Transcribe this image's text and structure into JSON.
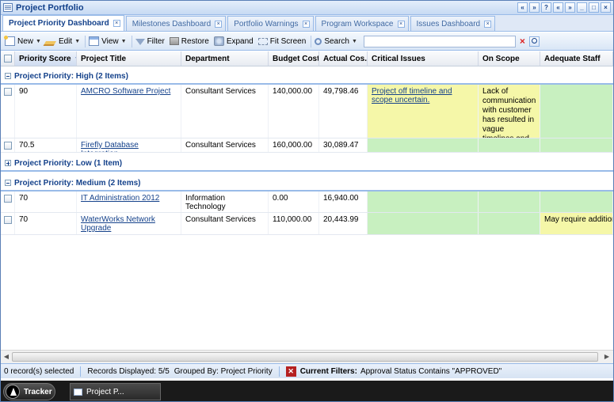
{
  "window": {
    "title": "Project Portfolio",
    "buttons": [
      "«",
      "»",
      "?",
      "«",
      "»",
      "_",
      "□",
      "×"
    ]
  },
  "tabs": [
    {
      "label": "Project Priority Dashboard",
      "active": true
    },
    {
      "label": "Milestones Dashboard",
      "active": false
    },
    {
      "label": "Portfolio Warnings",
      "active": false
    },
    {
      "label": "Program Workspace",
      "active": false
    },
    {
      "label": "Issues Dashboard",
      "active": false
    }
  ],
  "toolbar": {
    "new_label": "New",
    "edit_label": "Edit",
    "view_label": "View",
    "filter_label": "Filter",
    "restore_label": "Restore",
    "expand_label": "Expand",
    "fit_label": "Fit Screen",
    "search_label": "Search",
    "search_value": ""
  },
  "grid": {
    "columns": [
      "Priority Score",
      "Project Title",
      "Department",
      "Budget Cost...",
      "Actual Cos...",
      "Critical Issues",
      "On Scope",
      "Adequate Staff"
    ],
    "groups": [
      {
        "label": "Project Priority: High (2 Items)",
        "expanded": true,
        "rows": [
          {
            "score": "90",
            "title": "AMCRO Software Project",
            "department": "Consultant Services",
            "budget": "140,000.00",
            "actual": "49,798.46",
            "critical": "Project off timeline and scope uncertain.",
            "scope": "Lack of communication with customer has resulted in vague timelines and deliverables",
            "staff": ""
          },
          {
            "score": "70.5",
            "title": "Firefly Database Integration",
            "department": "Consultant Services",
            "budget": "160,000.00",
            "actual": "30,089.47",
            "critical": "",
            "scope": "",
            "staff": ""
          }
        ]
      },
      {
        "label": "Project Priority: Low (1 Item)",
        "expanded": false,
        "rows": []
      },
      {
        "label": "Project Priority: Medium (2 Items)",
        "expanded": true,
        "rows": [
          {
            "score": "70",
            "title": "IT Administration 2012",
            "department": "Information Technology",
            "budget": "0.00",
            "actual": "16,940.00",
            "critical": "",
            "scope": "",
            "staff": ""
          },
          {
            "score": "70",
            "title": "WaterWorks Network Upgrade",
            "department": "Consultant Services",
            "budget": "110,000.00",
            "actual": "20,443.99",
            "critical": "",
            "scope": "",
            "staff": "May require additional staff to meet deadline"
          }
        ]
      }
    ]
  },
  "status": {
    "selected": "0 record(s) selected",
    "displayed": "Records Displayed: 5/5",
    "grouped": "Grouped By: Project Priority",
    "filter_label": "Current Filters:",
    "filter_value": "Approval Status Contains \"APPROVED\""
  },
  "taskbar": {
    "start_label": "Tracker",
    "task_label": "Project P..."
  },
  "colors": {
    "caution": "#f5f7a8",
    "ok": "#c8f0c0",
    "accent": "#15428b"
  }
}
